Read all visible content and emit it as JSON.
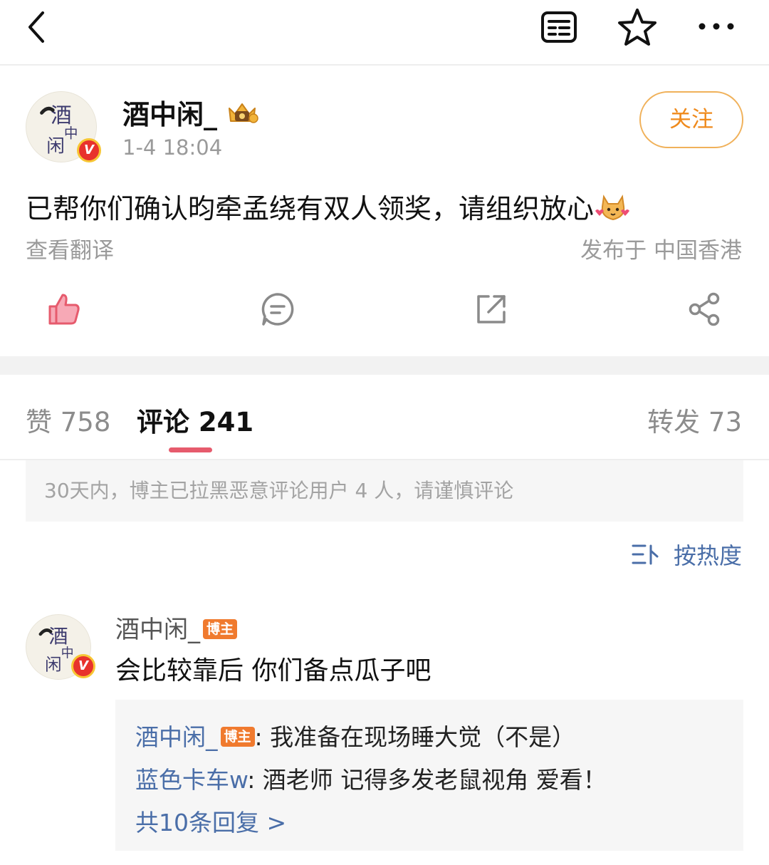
{
  "colors": {
    "accent_orange": "#ef8a1c",
    "like_pink": "#e65b6d",
    "link_blue": "#4a6ea8",
    "verified_red": "#e8322c"
  },
  "topbar": {
    "icons": [
      "back-icon",
      "reader-mode-icon",
      "star-icon",
      "more-icon"
    ]
  },
  "post": {
    "author": {
      "name": "酒中闲_",
      "avatar_text": "酒中闲",
      "verified": "V",
      "crown_badge": "crown-level-icon"
    },
    "timestamp": "1-4 18:04",
    "follow_label": "关注",
    "text": "已帮你们确认昀牵孟绕有双人领奖，请组织放心",
    "translate_label": "查看翻译",
    "location": "发布于 中国香港",
    "actions": [
      "like-icon",
      "comment-icon",
      "repost-icon",
      "share-icon"
    ]
  },
  "tabs": {
    "likes": "赞 758",
    "comments": "评论 241",
    "reposts": "转发 73"
  },
  "notice": "30天内，博主已拉黑恶意评论用户 4 人，请谨慎评论",
  "sort_label": "按热度",
  "comment": {
    "author": "酒中闲_",
    "author_tag": "博主",
    "text": "会比较靠后 你们备点瓜子吧",
    "replies": [
      {
        "name": "酒中闲_",
        "tag": "博主",
        "text": ": 我准备在现场睡大觉（不是）"
      },
      {
        "name": "蓝色卡车w",
        "tag": "",
        "text": ": 酒老师 记得多发老鼠视角 爱看！"
      }
    ],
    "more_replies": "共10条回复 >"
  }
}
